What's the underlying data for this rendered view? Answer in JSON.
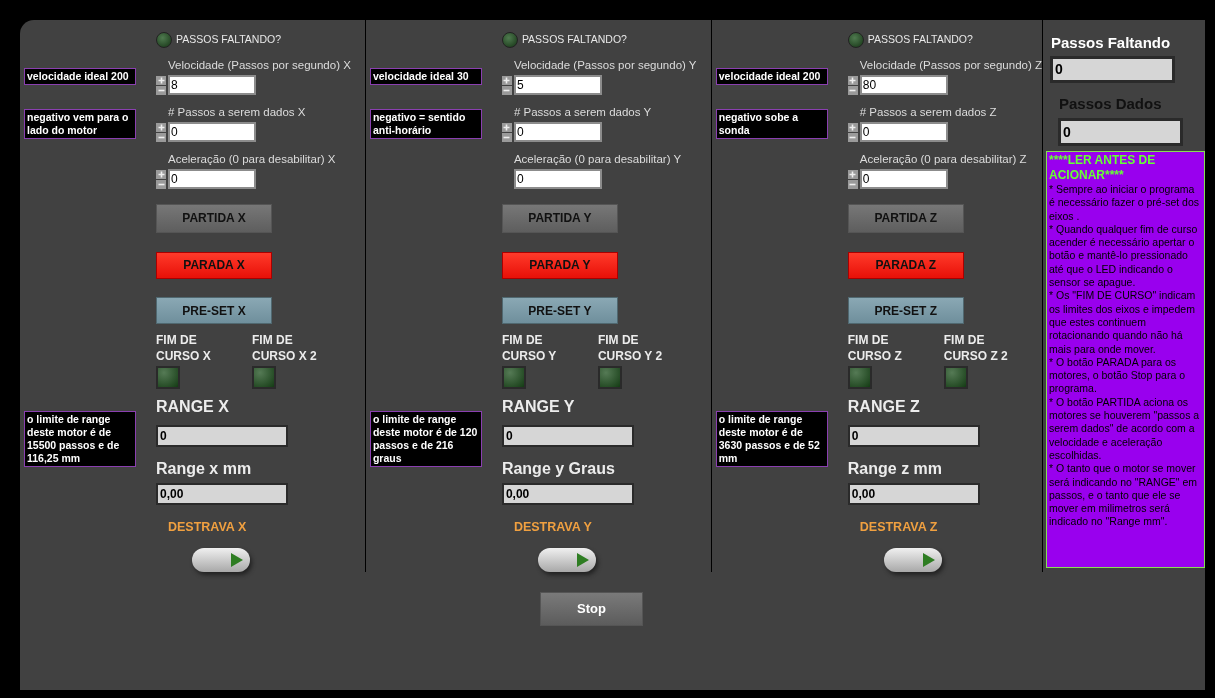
{
  "axes": [
    {
      "remaining_led": {
        "label": "PASSOS FALTANDO?",
        "on": false
      },
      "notes": [
        "velocidade ideal 200",
        "negativo vem para o lado do motor"
      ],
      "range_note": "o limite de range deste motor é de 15500 passos e de 116,25 mm",
      "inputs": [
        {
          "label": "Velocidade (Passos por segundo) X",
          "value": "8",
          "kind": "stepper"
        },
        {
          "label": "# Passos a serem dados X",
          "value": "0",
          "kind": "stepper"
        },
        {
          "label": "Aceleração (0 para desabilitar) X",
          "value": "0",
          "kind": "stepper"
        }
      ],
      "start_button": "PARTIDA X",
      "stop_button": "PARADA X",
      "preset_button": "PRE-SET X",
      "limit_switches": [
        {
          "label": "FIM DE CURSO X",
          "on": false
        },
        {
          "label": "FIM DE CURSO X 2",
          "on": false
        }
      ],
      "range": {
        "label": "RANGE X",
        "value": "0"
      },
      "range_units": {
        "label": "Range x mm",
        "value": "0,00"
      },
      "unlock": {
        "label": "DESTRAVA X",
        "on": false
      }
    },
    {
      "remaining_led": {
        "label": "PASSOS FALTANDO?",
        "on": false
      },
      "notes": [
        "velocidade ideal 30",
        "negativo = sentido anti-horário"
      ],
      "range_note": "o limite de range deste motor é de 120 passos e de 216 graus",
      "inputs": [
        {
          "label": "Velocidade (Passos por segundo) Y",
          "value": "5",
          "kind": "stepper"
        },
        {
          "label": "# Passos a serem dados Y",
          "value": "0",
          "kind": "stepper"
        },
        {
          "label": "Aceleração (0 para desabilitar) Y",
          "value": "0",
          "kind": "plain"
        }
      ],
      "start_button": "PARTIDA Y",
      "stop_button": "PARADA Y",
      "preset_button": "PRE-SET Y",
      "limit_switches": [
        {
          "label": "FIM DE CURSO Y",
          "on": false
        },
        {
          "label": "FIM DE CURSO Y 2",
          "on": false
        }
      ],
      "range": {
        "label": "RANGE Y",
        "value": "0"
      },
      "range_units": {
        "label": "Range y Graus",
        "value": "0,00"
      },
      "unlock": {
        "label": "DESTRAVA Y",
        "on": false
      }
    },
    {
      "remaining_led": {
        "label": "PASSOS FALTANDO?",
        "on": false
      },
      "notes": [
        "velocidade ideal 200",
        "negativo sobe a sonda"
      ],
      "range_note": "o limite de range deste motor é de 3630 passos e de 52 mm",
      "inputs": [
        {
          "label": "Velocidade (Passos por segundo) Z",
          "value": "80",
          "kind": "stepper"
        },
        {
          "label": "# Passos a serem dados Z",
          "value": "0",
          "kind": "stepper"
        },
        {
          "label": "Aceleração (0 para desabilitar) Z",
          "value": "0",
          "kind": "stepper"
        }
      ],
      "start_button": "PARTIDA Z",
      "stop_button": "PARADA  Z",
      "preset_button": "PRE-SET Z",
      "limit_switches": [
        {
          "label": "FIM DE CURSO Z",
          "on": false
        },
        {
          "label": "FIM DE CURSO Z 2",
          "on": false
        }
      ],
      "range": {
        "label": "RANGE Z",
        "value": "0"
      },
      "range_units": {
        "label": "Range z mm",
        "value": "0,00"
      },
      "unlock": {
        "label": "DESTRAVA Z",
        "on": false
      }
    }
  ],
  "summary": {
    "remaining": {
      "label": "Passos Faltando",
      "value": "0"
    },
    "done": {
      "label": "Passos Dados",
      "value": "0"
    },
    "instructions": {
      "title": "****LER ANTES DE ACIONAR****",
      "lines": [
        "* Sempre ao iniciar o programa é necessário fazer o pré-set dos eixos .",
        "* Quando qualquer fim de curso acender é necessário apertar o botão e mantê-lo pressionado até que  o LED indicando o sensor se apague.",
        "* Os \"FIM DE CURSO\" indicam os limites dos eixos e impedem que estes continuem rotacionando quando não há mais para onde mover.",
        "* O botão PARADA para os motores, o botão Stop para o programa.",
        "* O botão PARTIDA aciona os motores se houverem \"passos a  serem dados\" de acordo com a velocidade e aceleração escolhidas.",
        "* O tanto que o motor se mover será indicando no \"RANGE\" em passos, e o tanto que ele se mover em milimetros será indicado no \"Range mm\"."
      ]
    }
  },
  "stop_button": "Stop"
}
